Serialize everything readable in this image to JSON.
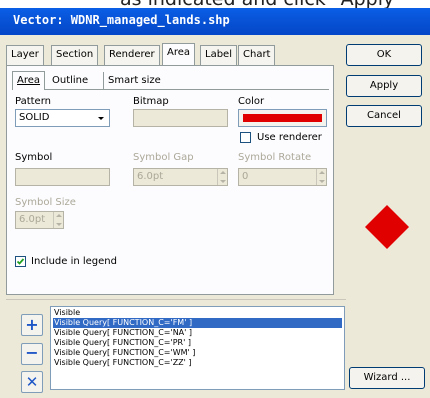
{
  "window": {
    "title": "Vector: WDNR_managed_lands.shp"
  },
  "tabs": [
    "Layer",
    "Section",
    "Renderer",
    "Area",
    "Label",
    "Chart"
  ],
  "subtabs": [
    "Area",
    "Outline",
    "Smart size"
  ],
  "buttons": {
    "ok": "OK",
    "apply": "Apply",
    "cancel": "Cancel",
    "wizard": "Wizard ..."
  },
  "area": {
    "pattern_label": "Pattern",
    "pattern_value": "SOLID",
    "bitmap_label": "Bitmap",
    "color_label": "Color",
    "color_value": "#e00000",
    "use_renderer_label": "Use renderer",
    "symbol_label": "Symbol",
    "symbol_gap_label": "Symbol Gap",
    "symbol_gap_value": "6.0pt",
    "symbol_rotate_label": "Symbol Rotate",
    "symbol_rotate_value": "0",
    "symbol_size_label": "Symbol Size",
    "symbol_size_value": "6.0pt",
    "include_legend_label": "Include in legend",
    "include_legend_checked": true
  },
  "preview": {
    "shape": "diamond",
    "color": "#e00000"
  },
  "renderer_list": [
    "Visible",
    "Visible Query[ FUNCTION_C='FM' ]",
    "Visible Query[ FUNCTION_C='NA' ]",
    "Visible Query[ FUNCTION_C='PR' ]",
    "Visible Query[ FUNCTION_C='WM' ]",
    "Visible Query[ FUNCTION_C='ZZ' ]"
  ],
  "renderer_selected": 1,
  "list_buttons": {
    "add": "+",
    "remove": "−",
    "delete": "✕"
  },
  "top_clip": "as indicated and click \"Apply\""
}
